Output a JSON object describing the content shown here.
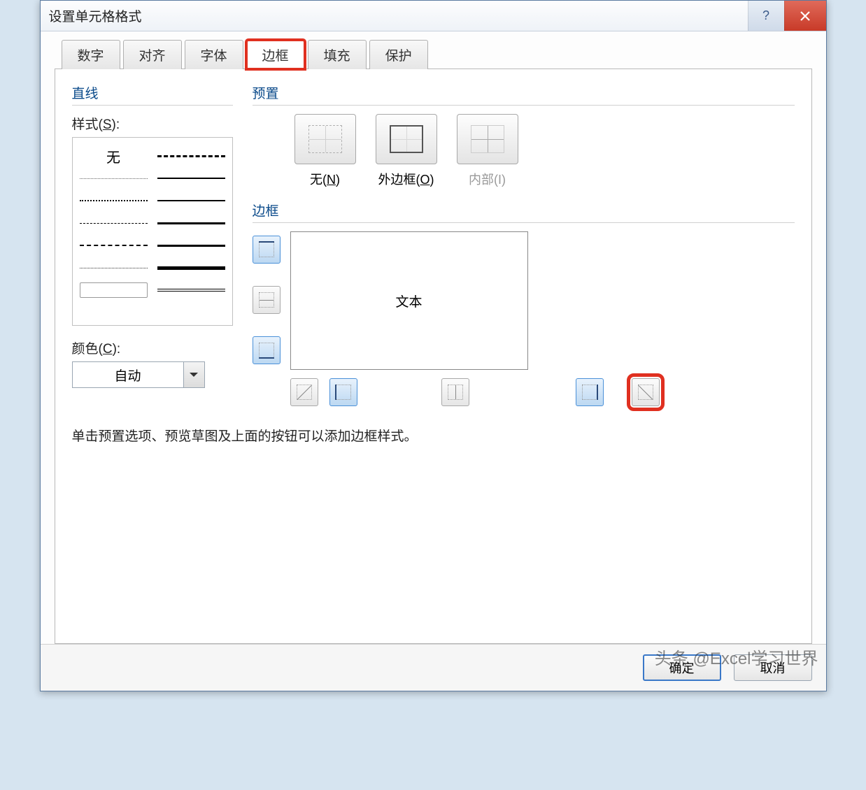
{
  "titlebar": {
    "title": "设置单元格格式"
  },
  "tabs": [
    "数字",
    "对齐",
    "字体",
    "边框",
    "填充",
    "保护"
  ],
  "active_tab_index": 3,
  "line_group": {
    "title": "直线",
    "style_label": "样式(S):",
    "none_label": "无",
    "color_label": "颜色(C):",
    "color_value": "自动"
  },
  "presets": {
    "title": "预置",
    "items": [
      {
        "label": "无(N)"
      },
      {
        "label": "外边框(O)"
      },
      {
        "label": "内部(I)",
        "disabled": true
      }
    ]
  },
  "border_group": {
    "title": "边框",
    "preview_text": "文本"
  },
  "hint": "单击预置选项、预览草图及上面的按钮可以添加边框样式。",
  "buttons": {
    "ok": "确定",
    "cancel": "取消"
  },
  "watermark": "头条 @Excel学习世界"
}
